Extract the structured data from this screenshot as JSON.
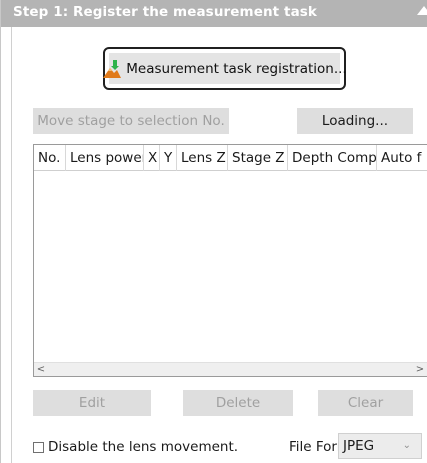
{
  "header": {
    "title": "Step 1: Register the measurement task"
  },
  "registration": {
    "button_label": "Measurement task registration..."
  },
  "stage_controls": {
    "move_label": "Move stage to selection No.",
    "loading_label": "Loading..."
  },
  "table": {
    "columns": [
      "No.",
      "Lens power",
      "X",
      "Y",
      "Lens Z",
      "Stage Z",
      "Depth Comp",
      "Auto f"
    ],
    "rows": []
  },
  "scrollbar": {
    "left_arrow": "<",
    "right_arrow": ">"
  },
  "actions": {
    "edit_label": "Edit",
    "delete_label": "Delete",
    "clear_label": "Clear"
  },
  "options": {
    "disable_lens_label": "Disable the lens movement.",
    "disable_lens_checked": false,
    "file_format_label": "File Format:",
    "file_format_value": "JPEG"
  },
  "icons": {
    "registration": "mountain-with-download-arrow-icon",
    "collapse": "triangle-up-icon",
    "dropdown": "chevron-down-icon"
  },
  "colors": {
    "header_bg": "#b4b4b4",
    "button_bg": "#dedede",
    "icon_arrow": "#2db34a",
    "icon_mountain": "#e07a1a"
  }
}
